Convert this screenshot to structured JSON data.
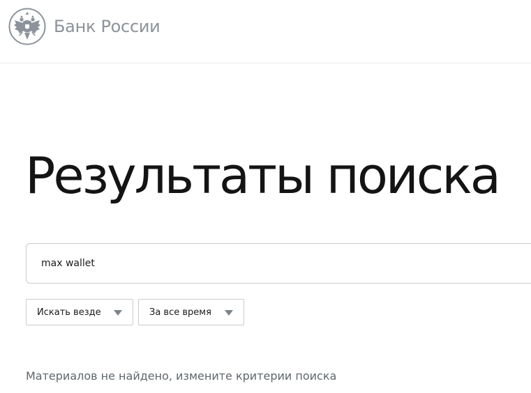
{
  "header": {
    "logo_text": "Банк России",
    "logo_icon": "double-headed-eagle-emblem-icon",
    "logo_color": "#8c939b"
  },
  "main": {
    "title": "Результаты поиска",
    "search": {
      "value": "max wallet",
      "placeholder": ""
    },
    "filters": {
      "scope": {
        "selected": "Искать везде"
      },
      "period": {
        "selected": "За все время"
      }
    },
    "empty_message": "Материалов не найдено, измените критерии поиска"
  },
  "colors": {
    "text": "#141414",
    "muted": "#5f666d",
    "border": "#c9cdd1",
    "chevron": "#7b838b"
  }
}
